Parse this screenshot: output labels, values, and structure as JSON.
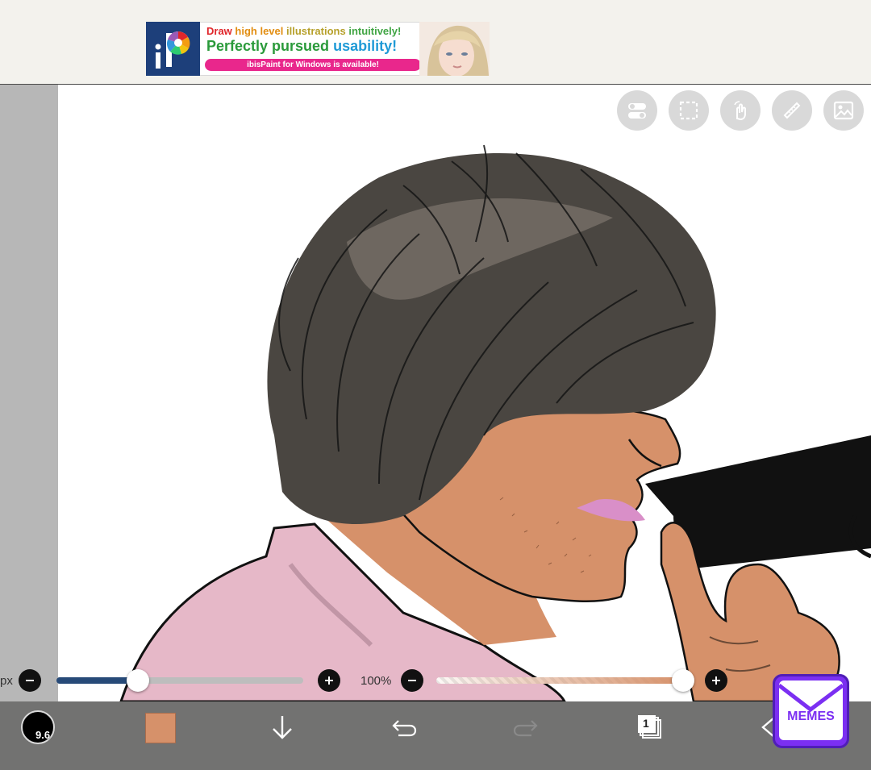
{
  "ad": {
    "line1_word1": "Draw",
    "line1_word2": "high level",
    "line1_word3": "illustrations",
    "line1_word4": "intuitively!",
    "line2_word1": "Perfectly pursued",
    "line2_word2": "usability!",
    "footer": "ibisPaint for Windows is available!"
  },
  "toolbar_top": {
    "icons": [
      "toggle-icon",
      "selection-icon",
      "gesture-icon",
      "ruler-icon",
      "reference-image-icon"
    ]
  },
  "brush_size": {
    "unit_label": "px",
    "value_fraction": 0.33
  },
  "opacity": {
    "label": "100%",
    "value_fraction": 1.0
  },
  "bottom_bar": {
    "brush_value": "9.6",
    "color_swatch": "#d6916a",
    "layer_count": "1",
    "icons": [
      "brush-preview-icon",
      "color-swatch",
      "down-arrow-icon",
      "undo-icon",
      "redo-icon",
      "layers-icon",
      "back-icon"
    ]
  },
  "badge": {
    "text": "MEMES"
  },
  "colors": {
    "skin": "#d6916a",
    "shirt": "#e6b8c8",
    "hair_dark": "#2b2b2b",
    "slider_fill": "#274a78",
    "badge": "#7b2ff2"
  }
}
